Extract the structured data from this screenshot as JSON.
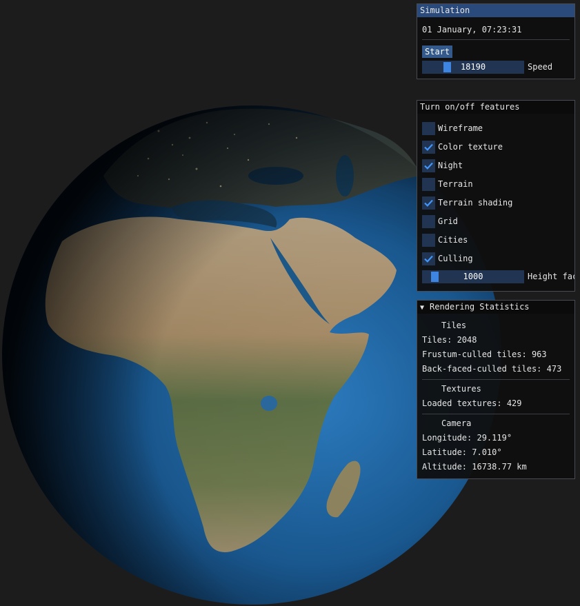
{
  "simulation": {
    "title": "Simulation",
    "datetime": "01 January, 07:23:31",
    "start_label": "Start",
    "speed_value": "18190",
    "speed_label": "Speed",
    "speed_fraction": 0.22
  },
  "features": {
    "title": "Turn on/off features",
    "items": [
      {
        "label": "Wireframe",
        "checked": false
      },
      {
        "label": "Color texture",
        "checked": true
      },
      {
        "label": "Night",
        "checked": true
      },
      {
        "label": "Terrain",
        "checked": false
      },
      {
        "label": "Terrain shading",
        "checked": true
      },
      {
        "label": "Grid",
        "checked": false
      },
      {
        "label": "Cities",
        "checked": false
      },
      {
        "label": "Culling",
        "checked": true
      }
    ],
    "height_value": "1000",
    "height_label": "Height factor",
    "height_fraction": 0.08
  },
  "stats": {
    "title": "Rendering Statistics",
    "tiles_header": "Tiles",
    "tiles": "Tiles: 2048",
    "frustum": "Frustum-culled tiles: 963",
    "backface": "Back-faced-culled tiles: 473",
    "textures_header": "Textures",
    "loaded_textures": "Loaded textures: 429",
    "camera_header": "Camera",
    "longitude": "Longitude: 29.119°",
    "latitude": "Latitude: 7.010°",
    "altitude": "Altitude: 16738.77 km"
  },
  "colors": {
    "title_active": "#294a7a",
    "widget_bg": "#213553",
    "accent": "#3d85e0",
    "checkmark": "#4296fa"
  }
}
